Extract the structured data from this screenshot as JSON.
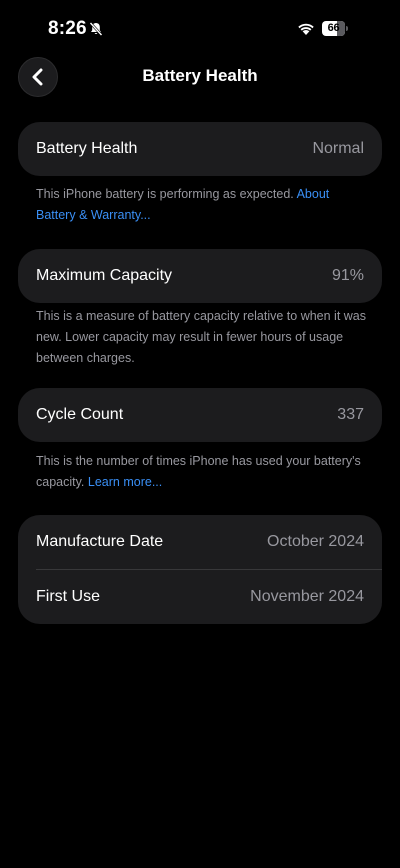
{
  "status_bar": {
    "time": "8:26",
    "battery_level": "66",
    "battery_fraction": 0.66
  },
  "header": {
    "title": "Battery Health"
  },
  "battery_health": {
    "label": "Battery Health",
    "value": "Normal",
    "note": "This iPhone battery is performing as expected.",
    "link": "About Battery & Warranty..."
  },
  "maximum_capacity": {
    "label": "Maximum Capacity",
    "value": "91%",
    "note": "This is a measure of battery capacity relative to when it was new. Lower capacity may result in fewer hours of usage between charges."
  },
  "cycle_count": {
    "label": "Cycle Count",
    "value": "337",
    "note": "This is the number of times iPhone has used your battery's capacity.",
    "link": "Learn more..."
  },
  "dates": {
    "manufacture_label": "Manufacture Date",
    "manufacture_value": "October 2024",
    "first_use_label": "First Use",
    "first_use_value": "November 2024"
  },
  "colors": {
    "background": "#000000",
    "card": "#1c1c1e",
    "secondary_text": "#98989f",
    "link": "#3a8ff5"
  },
  "icons": {
    "back": "chevron-left-icon",
    "silent": "bell-slash-icon",
    "wifi": "wifi-icon",
    "battery": "battery-icon"
  }
}
